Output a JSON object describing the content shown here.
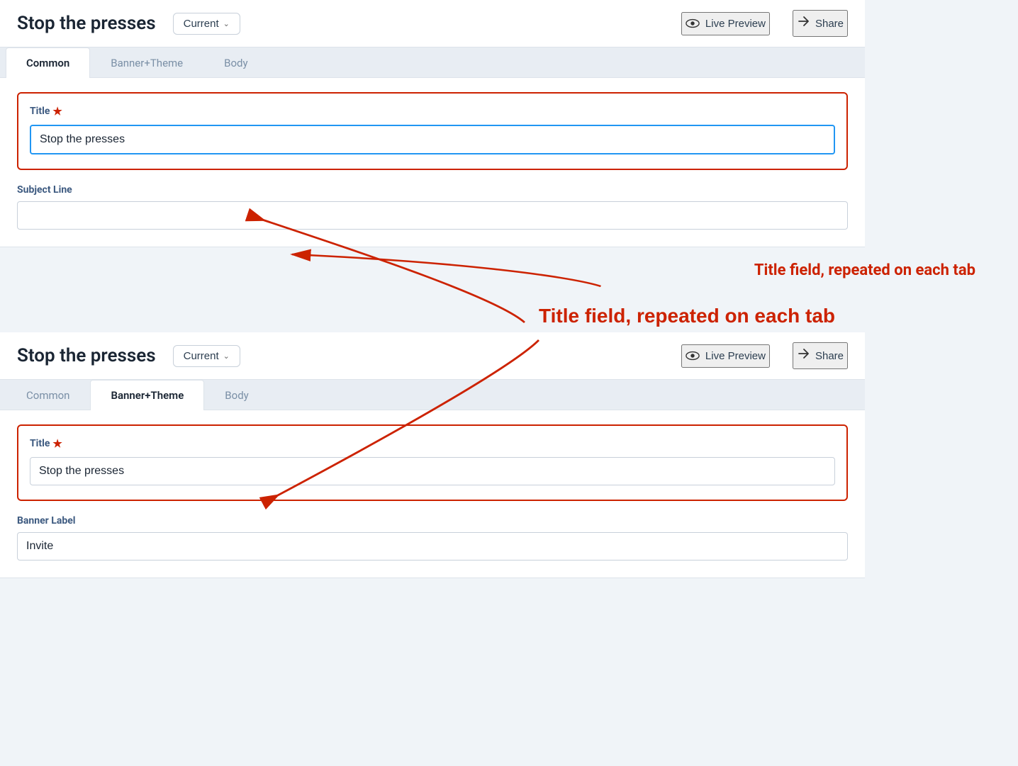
{
  "app": {
    "title": "Stop the presses",
    "current_label": "Current",
    "live_preview_label": "Live Preview",
    "share_label": "Share"
  },
  "tabs": {
    "common_label": "Common",
    "banner_theme_label": "Banner+Theme",
    "body_label": "Body"
  },
  "top_panel": {
    "active_tab": "common",
    "title_field": {
      "label": "Title",
      "value": "Stop the presses",
      "required": true
    },
    "subject_line_field": {
      "label": "Subject Line",
      "value": "",
      "placeholder": ""
    }
  },
  "bottom_panel": {
    "active_tab": "banner_theme",
    "title_field": {
      "label": "Title",
      "value": "Stop the presses",
      "required": true
    },
    "banner_label_field": {
      "label": "Banner Label",
      "value": "Invite",
      "placeholder": ""
    }
  },
  "annotation": {
    "text": "Title field, repeated on each tab"
  }
}
